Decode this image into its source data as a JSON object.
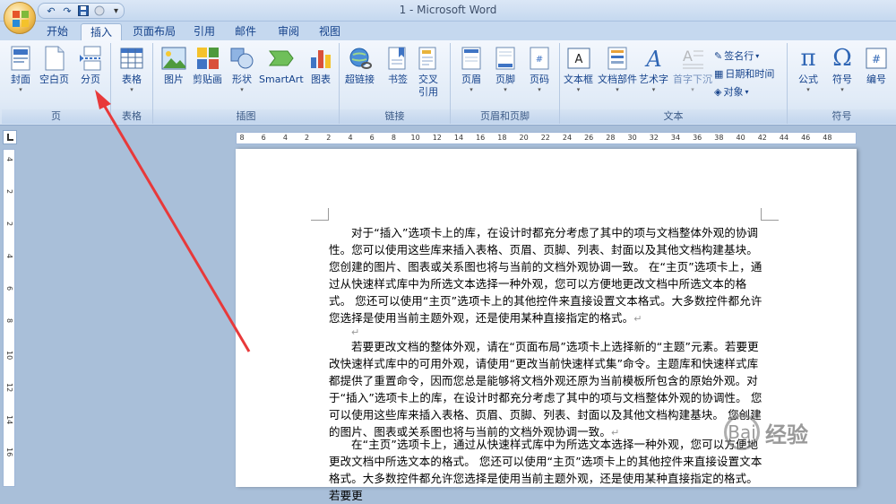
{
  "window": {
    "title": "1 - Microsoft Word"
  },
  "quick_access": {
    "undo_icon": "undo-icon",
    "redo_icon": "redo-icon",
    "save_icon": "save-icon",
    "more": "▾"
  },
  "tabs": [
    {
      "label": "开始"
    },
    {
      "label": "插入"
    },
    {
      "label": "页面布局"
    },
    {
      "label": "引用"
    },
    {
      "label": "邮件"
    },
    {
      "label": "审阅"
    },
    {
      "label": "视图"
    }
  ],
  "ribbon": {
    "groups": {
      "page": "页",
      "table": "表格",
      "illustration": "插图",
      "link": "链接",
      "header_footer": "页眉和页脚",
      "text": "文本",
      "symbol": "符号"
    },
    "buttons": {
      "cover": "封面",
      "blank_page": "空白页",
      "page_break": "分页",
      "table": "表格",
      "picture": "图片",
      "clipart": "剪贴画",
      "shapes": "形状",
      "smartart": "SmartArt",
      "chart": "图表",
      "hyperlink": "超链接",
      "bookmark": "书签",
      "cross_ref_1": "交叉",
      "cross_ref_2": "引用",
      "header": "页眉",
      "footer": "页脚",
      "page_number": "页码",
      "textbox": "文本框",
      "quick_parts": "文档部件",
      "wordart": "艺术字",
      "dropcap": "首字下沉",
      "signature": "签名行",
      "datetime": "日期和时间",
      "object": "对象",
      "formula": "公式",
      "symbol": "符号",
      "numbering": "编号"
    }
  },
  "ruler": {
    "h_ticks": [
      "8",
      "6",
      "4",
      "2",
      "2",
      "4",
      "6",
      "8",
      "10",
      "12",
      "14",
      "16",
      "18",
      "20",
      "22",
      "24",
      "26",
      "28",
      "30",
      "32",
      "34",
      "36",
      "38",
      "40",
      "42",
      "44",
      "46",
      "48"
    ],
    "v_ticks": [
      "4",
      "2",
      "2",
      "4",
      "6",
      "8",
      "10",
      "12",
      "14",
      "16"
    ]
  },
  "document": {
    "paragraphs": [
      "对于“插入”选项卡上的库，在设计时都充分考虑了其中的项与文档整体外观的协调性。您可以使用这些库来插入表格、页眉、页脚、列表、封面以及其他文档构建基块。 您创建的图片、图表或关系图也将与当前的文档外观协调一致。 在“主页”选项卡上，通过从快速样式库中为所选文本选择一种外观，您可以方便地更改文档中所选文本的格式。 您还可以使用“主页”选项卡上的其他控件来直接设置文本格式。大多数控件都允许您选择是使用当前主题外观，还是使用某种直接指定的格式。",
      "",
      "若要更改文档的整体外观，请在“页面布局”选项卡上选择新的“主题”元素。若要更改快速样式库中的可用外观，请使用“更改当前快速样式集”命令。主题库和快速样式库都提供了重置命令，因而您总是能够将文档外观还原为当前模板所包含的原始外观。对于“插入”选项卡上的库，在设计时都充分考虑了其中的项与文档整体外观的协调性。 您可以使用这些库来插入表格、页眉、页脚、列表、封面以及其他文档构建基块。 您创建的图片、图表或关系图也将与当前的文档外观协调一致。",
      "在“主页”选项卡上，通过从快速样式库中为所选文本选择一种外观，您可以方便地更改文档中所选文本的格式。 您还可以使用“主页”选项卡上的其他控件来直接设置文本格式。大多数控件都允许您选择是使用当前主题外观，还是使用某种直接指定的格式。若要更"
    ],
    "return_mark": "↵"
  },
  "watermark": {
    "text": "经验",
    "logo": "Bai"
  },
  "colors": {
    "accent": "#e8393a",
    "ribbon_bg": "#e1ebf7",
    "frame_bg": "#a9bfd9"
  }
}
